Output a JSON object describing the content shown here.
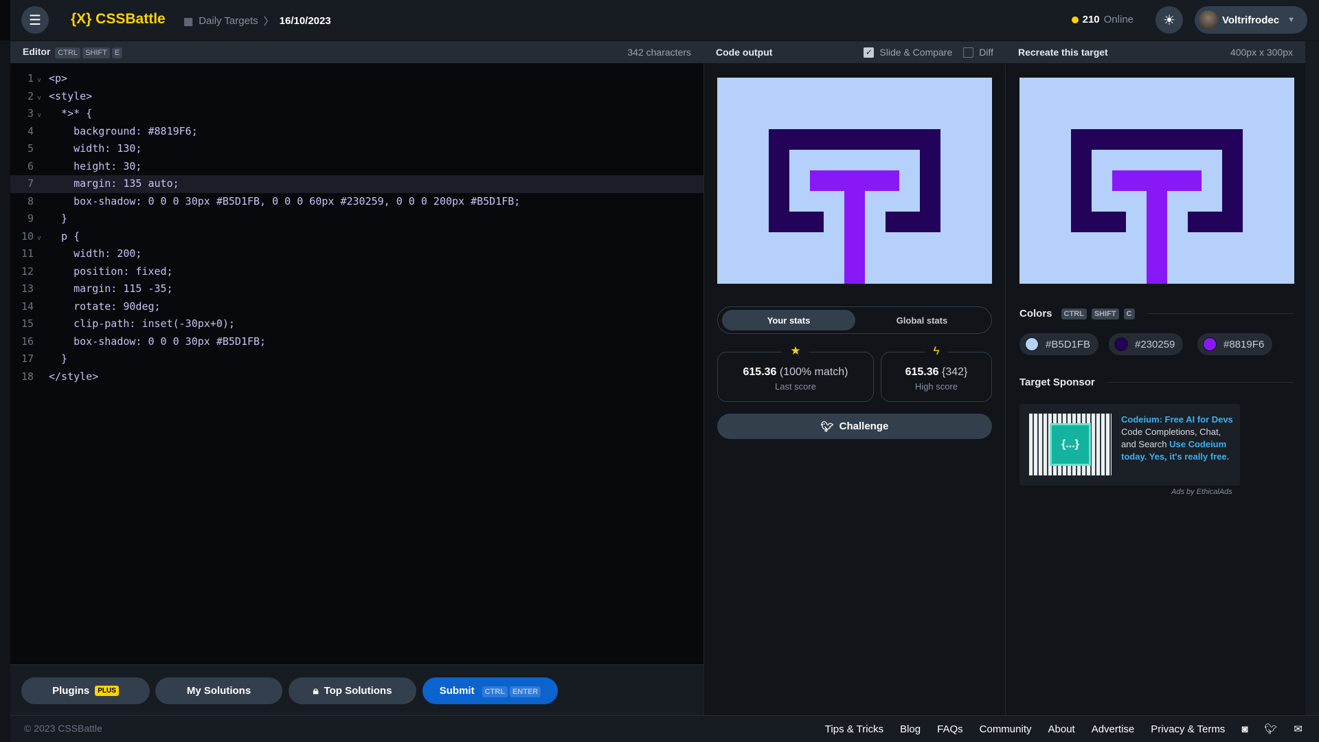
{
  "header": {
    "logo": "{X} CSSBattle",
    "breadcrumb_parent": "Daily Targets",
    "breadcrumb_current": "16/10/2023",
    "online_count": "210",
    "online_label": "Online",
    "username": "Voltrifrodec"
  },
  "editor": {
    "title": "Editor",
    "shortcut": [
      "CTRL",
      "SHIFT",
      "E"
    ],
    "char_count": "342 characters",
    "lines": [
      "<p>",
      "<style>",
      "  *>* {",
      "    background: #8819F6;",
      "    width: 130;",
      "    height: 30;",
      "    margin: 135 auto;",
      "    box-shadow: 0 0 0 30px #B5D1FB, 0 0 0 60px #230259, 0 0 0 200px #B5D1FB;",
      "  }",
      "  p {",
      "    width: 200;",
      "    position: fixed;",
      "    margin: 115 -35;",
      "    rotate: 90deg;",
      "    clip-path: inset(-30px+0);",
      "    box-shadow: 0 0 0 30px #B5D1FB;",
      "  }",
      "</style>"
    ],
    "active_line": 7
  },
  "output": {
    "title": "Code output",
    "slide_compare": "Slide & Compare",
    "slide_compare_checked": true,
    "diff": "Diff",
    "diff_checked": false
  },
  "target": {
    "title": "Recreate this target",
    "size": "400px x 300px"
  },
  "stats": {
    "tab_your": "Your stats",
    "tab_global": "Global stats",
    "last_score": "615.36",
    "last_match": "(100% match)",
    "last_label": "Last score",
    "high_score": "615.36",
    "high_chars": "{342}",
    "high_label": "High score",
    "challenge": "Challenge"
  },
  "colors": {
    "title": "Colors",
    "shortcut": [
      "CTRL",
      "SHIFT",
      "C"
    ],
    "swatches": [
      "#B5D1FB",
      "#230259",
      "#8819F6"
    ]
  },
  "sponsor": {
    "title": "Target Sponsor",
    "ad_title": "Codeium: Free AI for Devs",
    "ad_body": " Code Completions, Chat, and Search ",
    "ad_cta": "Use Codeium today. Yes, it's really free.",
    "ad_logo": "{...}",
    "ads_by": "Ads by EthicalAds"
  },
  "buttons": {
    "plugins": "Plugins",
    "plus": "PLUS",
    "my_solutions": "My Solutions",
    "top_solutions": "Top Solutions",
    "submit": "Submit",
    "submit_keys": [
      "CTRL",
      "ENTER"
    ]
  },
  "footer": {
    "copyright": "© 2023 CSSBattle",
    "links": [
      "Tips & Tricks",
      "Blog",
      "FAQs",
      "Community",
      "About",
      "Advertise",
      "Privacy & Terms"
    ]
  },
  "icons": {
    "menu": "hamburger-icon",
    "theme": "sun-icon",
    "calendar": "calendar-icon",
    "lock": "lock-icon",
    "twitter": "twitter-icon",
    "discord": "discord-icon",
    "mail": "mail-icon",
    "star": "star-icon",
    "bolt": "bolt-icon"
  }
}
